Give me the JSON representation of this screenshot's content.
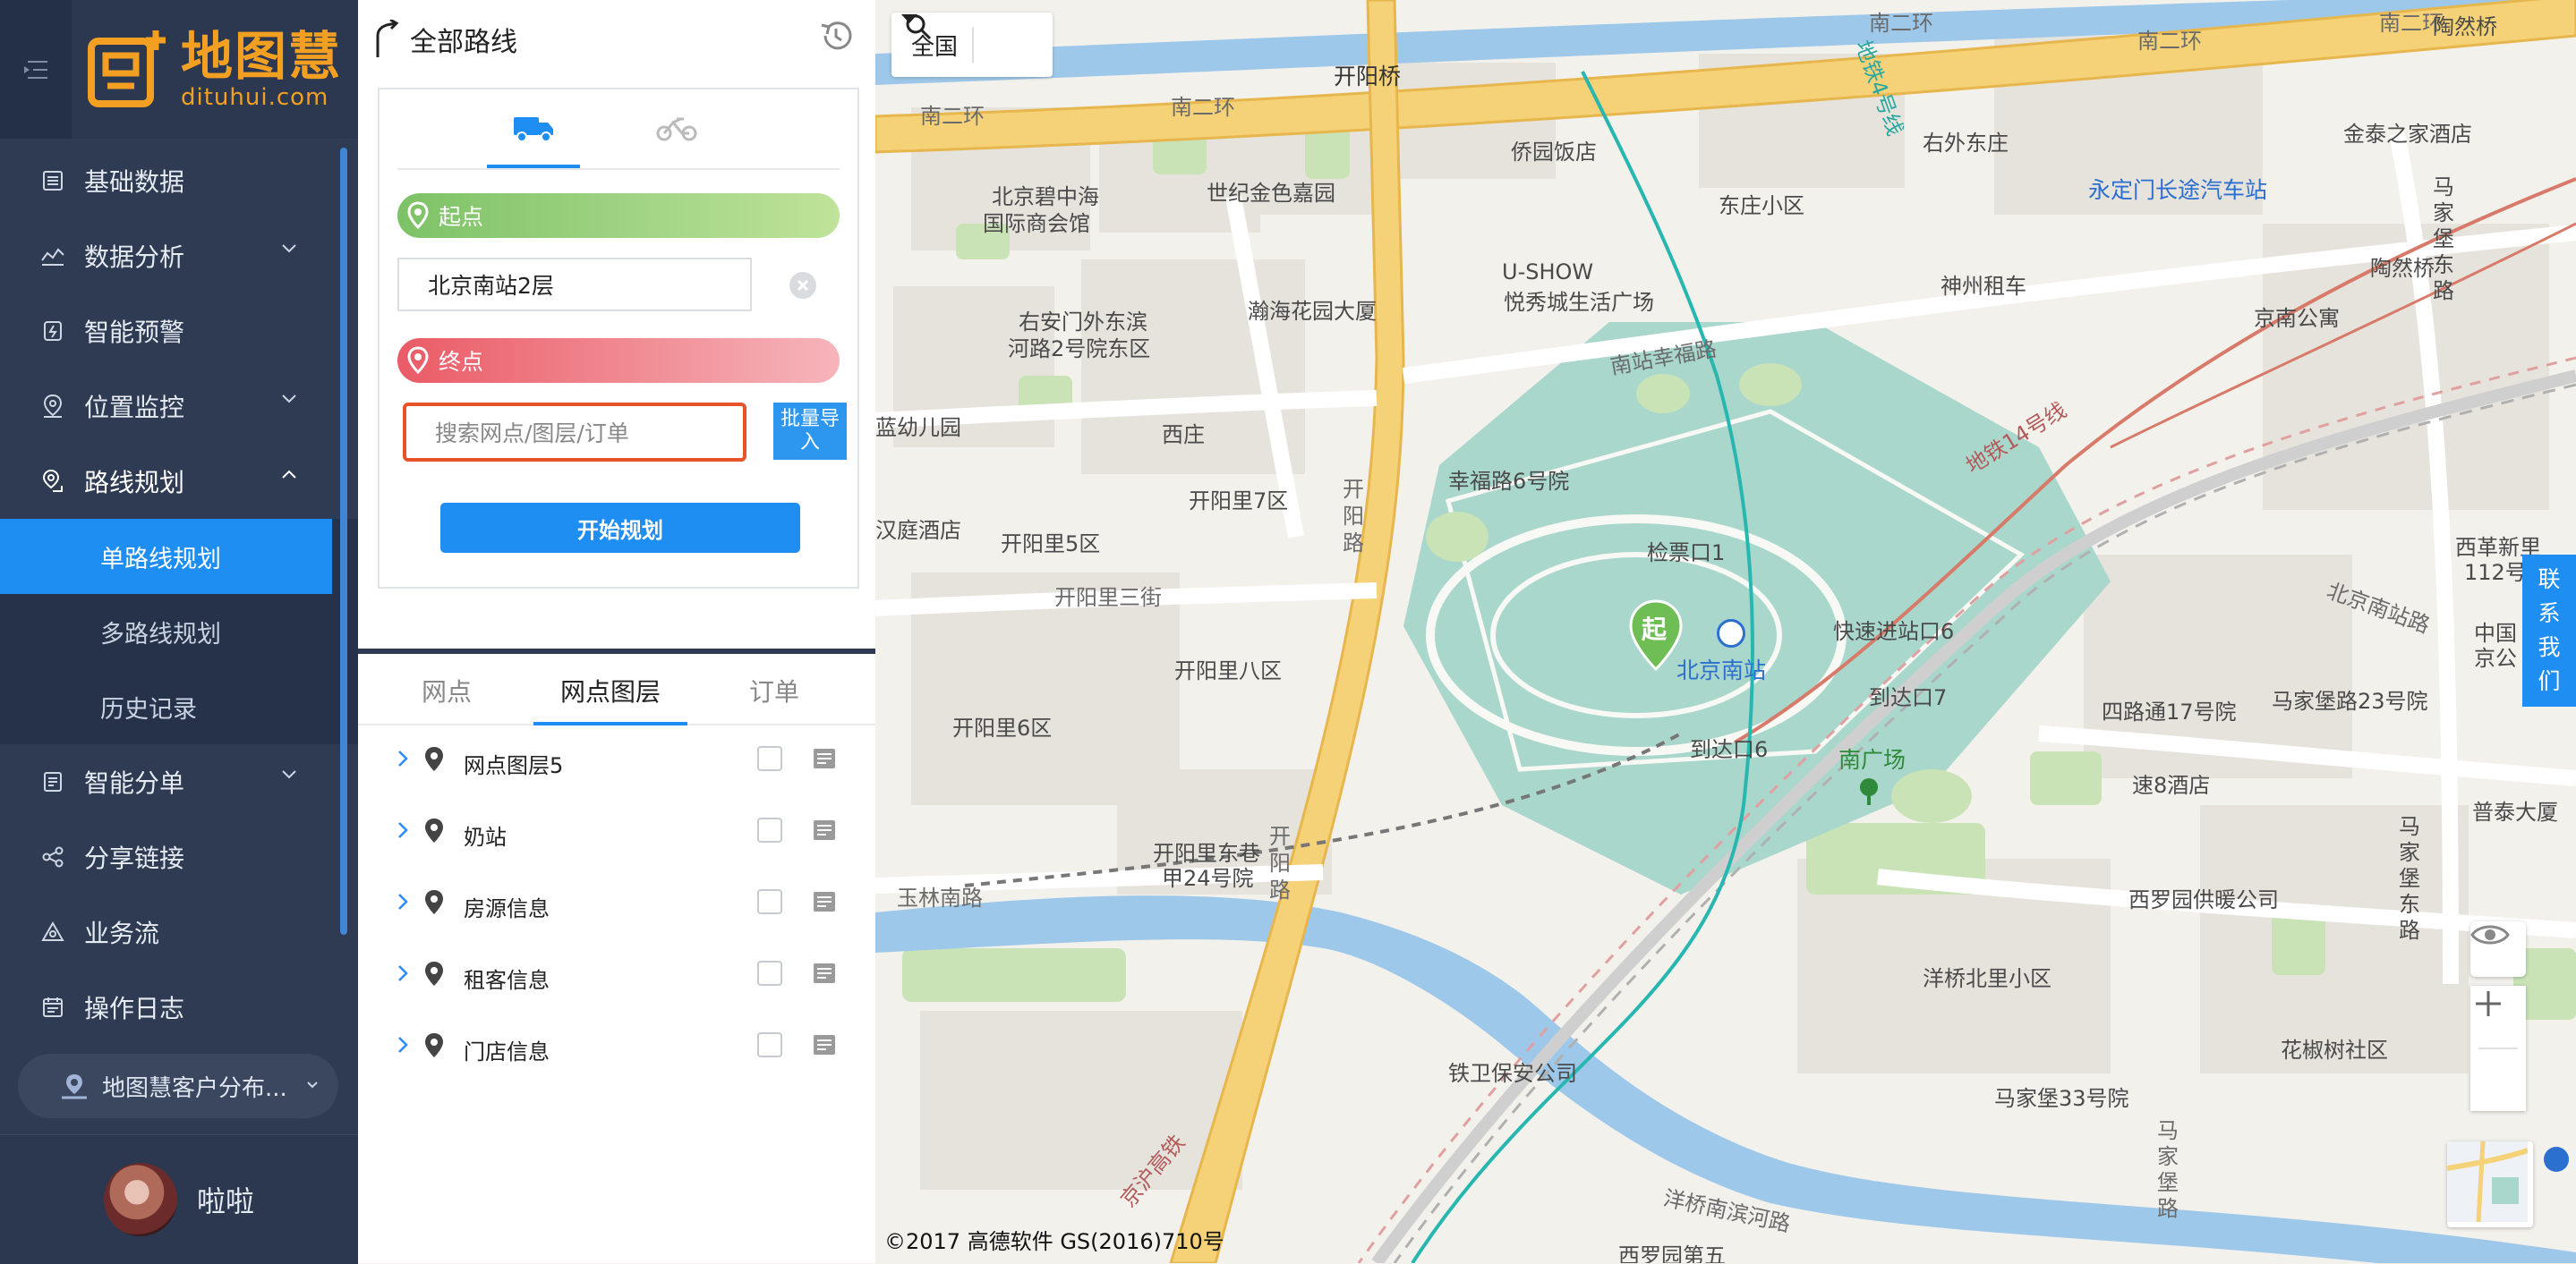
{
  "app": {
    "logo_cn": "地图慧",
    "logo_en": "dituhui.com"
  },
  "sidebar": {
    "items": [
      {
        "label": "基础数据",
        "icon": "database-icon",
        "has_chevron": false
      },
      {
        "label": "数据分析",
        "icon": "analysis-icon",
        "has_chevron": true
      },
      {
        "label": "智能预警",
        "icon": "alert-icon",
        "has_chevron": false
      },
      {
        "label": "位置监控",
        "icon": "location-icon",
        "has_chevron": true
      },
      {
        "label": "路线规划",
        "icon": "route-icon",
        "has_chevron": true,
        "expanded": true
      }
    ],
    "route_sub": [
      {
        "label": "单路线规划",
        "active": true
      },
      {
        "label": "多路线规划",
        "active": false
      },
      {
        "label": "历史记录",
        "active": false
      }
    ],
    "items_after": [
      {
        "label": "智能分单",
        "icon": "dispatch-icon",
        "has_chevron": true
      },
      {
        "label": "分享链接",
        "icon": "share-icon",
        "has_chevron": false
      },
      {
        "label": "业务流",
        "icon": "workflow-icon",
        "has_chevron": false
      },
      {
        "label": "操作日志",
        "icon": "log-icon",
        "has_chevron": false
      }
    ],
    "customer_label": "地图慧客户分布...",
    "user_name": "啦啦"
  },
  "panel": {
    "title": "全部路线",
    "start_label": "起点",
    "start_value": "北京南站2层",
    "end_label": "终点",
    "end_placeholder": "搜索网点/图层/订单",
    "batch_import": "批量导入",
    "plan_button": "开始规划",
    "tabs": [
      "网点",
      "网点图层",
      "订单"
    ],
    "active_tab": "网点图层",
    "layers": [
      "网点图层5",
      "奶站",
      "房源信息",
      "租客信息",
      "门店信息"
    ]
  },
  "map": {
    "region": "全国",
    "contact": [
      "联",
      "系",
      "我",
      "们"
    ],
    "copyright": "©2017 高德软件 GS(2016)710号",
    "start_marker": "起",
    "labels": {
      "l1": "开阳桥",
      "l2": "南二环",
      "l3": "南二环",
      "l4": "南二环",
      "l5": "南二环",
      "l6": "南二环",
      "l7": "陶然桥",
      "l8": "侨园饭店",
      "l9": "右外东庄",
      "l10": "金泰之家酒店",
      "l11": "北京碧中海",
      "l12": "国际商会馆",
      "l13": "世纪金色嘉园",
      "l14": "东庄小区",
      "l15": "永定门长途汽车站",
      "l16": "马家堡东路",
      "l17": "陶然桥",
      "l18": "U-SHOW",
      "l19": "悦秀城生活广场",
      "l20": "瀚海花园大厦",
      "l21": "神州租车",
      "l22": "右安门外东滨",
      "l23": "河路2号院东区",
      "l24": "京南公寓",
      "l25": "南站幸福路",
      "l26": "北京南站",
      "l27": "蓝幼儿园",
      "l28": "西庄",
      "l29": "幸福路6号院",
      "l30": "开阳里7区",
      "l31": "开阳路",
      "l32": "汉庭酒店",
      "l33": "开阳里5区",
      "l34": "检票口1",
      "l35": "西革新里",
      "l36": "112号",
      "l37": "开阳里三街",
      "l38": "快速进站口6",
      "l39": "北京南站路",
      "l40": "开阳里八区",
      "l41": "到达口7",
      "l42": "四路通17号院",
      "l43": "马家堡路23号院",
      "l44": "开阳里6区",
      "l45": "到达口6",
      "l46": "南广场",
      "l47": "中国",
      "l48": "京公",
      "l49": "速8酒店",
      "l50": "普泰大厦",
      "l51": "开阳里东巷",
      "l52": "甲24号院",
      "l53": "玉林南路",
      "l54": "开阳路",
      "l55": "西罗园供暖公司",
      "l56": "马家堡东路",
      "l57": "洋桥北里小区",
      "l58": "花椒树社区",
      "l59": "铁卫保安公司",
      "l60": "马家堡33号院",
      "l61": "马家堡路",
      "l62": "洋桥南滨河路",
      "l63": "西罗园第五",
      "l64": "京沪高铁",
      "l65": "地铁4号线",
      "l66": "地铁14号线"
    }
  }
}
